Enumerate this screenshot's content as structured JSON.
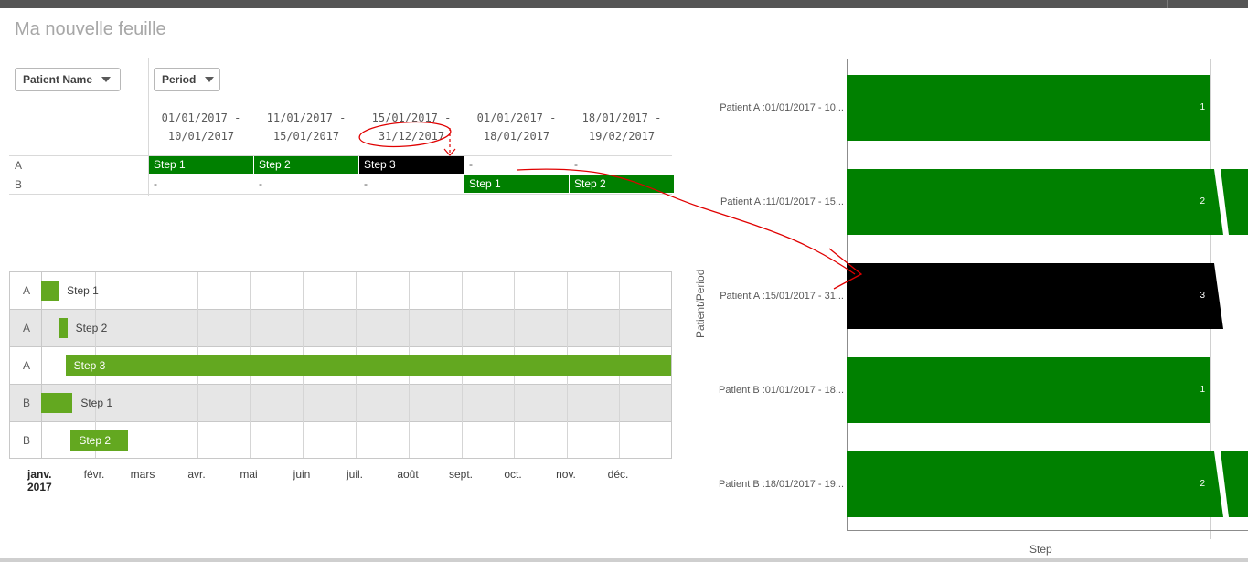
{
  "sheet": {
    "title": "Ma nouvelle feuille"
  },
  "pivot": {
    "dimension_buttons": [
      "Patient Name",
      "Period"
    ],
    "columns": [
      {
        "line1": "01/01/2017 -",
        "line2": "10/01/2017"
      },
      {
        "line1": "11/01/2017 -",
        "line2": "15/01/2017"
      },
      {
        "line1": "15/01/2017 -",
        "line2": "31/12/2017"
      },
      {
        "line1": "01/01/2017 -",
        "line2": "18/01/2017"
      },
      {
        "line1": "18/01/2017 -",
        "line2": "19/02/2017"
      }
    ],
    "rows": [
      {
        "label": "A",
        "cells": [
          {
            "text": "Step 1",
            "style": "green"
          },
          {
            "text": "Step 2",
            "style": "green"
          },
          {
            "text": "Step 3",
            "style": "black"
          },
          {
            "text": "-",
            "style": "dash"
          },
          {
            "text": "-",
            "style": "dash"
          }
        ]
      },
      {
        "label": "B",
        "cells": [
          {
            "text": "-",
            "style": "dash"
          },
          {
            "text": "-",
            "style": "dash"
          },
          {
            "text": "-",
            "style": "dash"
          },
          {
            "text": "Step 1",
            "style": "green"
          },
          {
            "text": "Step 2",
            "style": "green"
          }
        ]
      }
    ]
  },
  "gantt": {
    "rows": [
      {
        "label": "A",
        "step": "Step 1",
        "start": "2017-01-01",
        "end": "2017-01-10"
      },
      {
        "label": "A",
        "step": "Step 2",
        "start": "2017-01-11",
        "end": "2017-01-15"
      },
      {
        "label": "A",
        "step": "Step 3",
        "start": "2017-01-15",
        "end": "2017-12-31"
      },
      {
        "label": "B",
        "step": "Step 1",
        "start": "2017-01-01",
        "end": "2017-01-18"
      },
      {
        "label": "B",
        "step": "Step 2",
        "start": "2017-01-18",
        "end": "2017-02-19"
      }
    ],
    "months": [
      "janv.",
      "févr.",
      "mars",
      "avr.",
      "mai",
      "juin",
      "juil.",
      "août",
      "sept.",
      "oct.",
      "nov.",
      "déc."
    ],
    "year_label": "2017"
  },
  "chart_data": {
    "type": "bar",
    "orientation": "horizontal",
    "categories": [
      "Patient A :01/01/2017 - 10...",
      "Patient A :11/01/2017 - 15...",
      "Patient A :15/01/2017 - 31...",
      "Patient B :01/01/2017 - 18...",
      "Patient B :18/01/2017 - 19..."
    ],
    "values": [
      1,
      2,
      3,
      1,
      2
    ],
    "bar_colors": [
      "#008000",
      "#008000",
      "#000000",
      "#008000",
      "#008000"
    ],
    "xlabel": "Step",
    "ylabel": "Patient/Period",
    "axis_break": true,
    "grid": true
  },
  "colors": {
    "green": "#008000",
    "gantt_green": "#63a820",
    "black": "#000000",
    "annotation": "#e00000"
  }
}
